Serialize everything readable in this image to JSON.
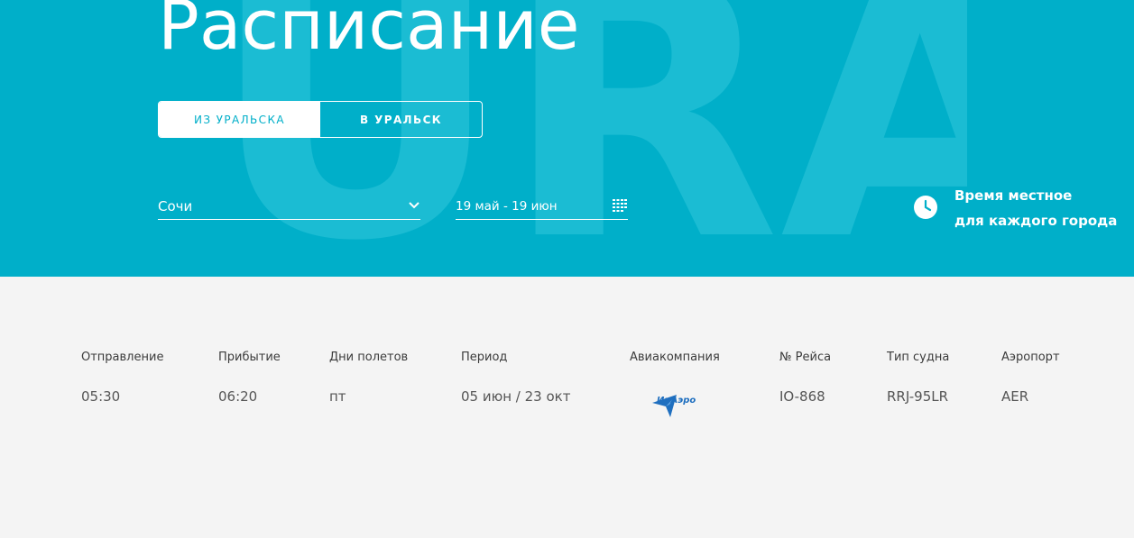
{
  "hero": {
    "title": "Расписание",
    "watermark_text": "URA",
    "toggle": {
      "from_label": "ИЗ УРАЛЬСКА",
      "to_label": "В УРАЛЬСК",
      "active": "from"
    },
    "city_select": {
      "value": "Сочи"
    },
    "date_range": {
      "value": "19 май - 19 июн"
    },
    "local_time_note": {
      "line1": "Время местное",
      "line2": "для каждого города"
    }
  },
  "schedule": {
    "columns": [
      "Отправление",
      "Прибытие",
      "Дни полетов",
      "Период",
      "Авиакомпания",
      "№ Рейса",
      "Тип судна",
      "Аэропорт"
    ],
    "rows": [
      {
        "departure": "05:30",
        "arrival": "06:20",
        "days": "пт",
        "period": "05 июн / 23 окт",
        "airline_logo_text": "ИрАэро",
        "flight": "IO-868",
        "aircraft": "RRJ-95LR",
        "airport": "AER"
      }
    ]
  },
  "colors": {
    "brand": "#00afc9",
    "background": "#f4f4f4",
    "logo_blue": "#1f6fbf"
  }
}
